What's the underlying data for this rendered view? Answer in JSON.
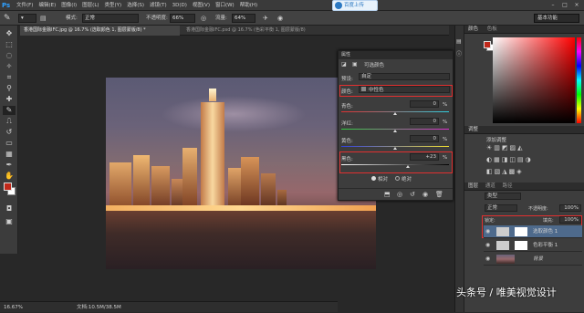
{
  "app": {
    "logo": "Ps"
  },
  "menu": {
    "items": [
      "文件(F)",
      "编辑(E)",
      "图像(I)",
      "图层(L)",
      "类型(Y)",
      "选择(S)",
      "滤镜(T)",
      "3D(D)",
      "视图(V)",
      "窗口(W)",
      "帮助(H)"
    ]
  },
  "cloud": {
    "label": "百度上传"
  },
  "options": {
    "mode_label": "模式:",
    "mode_value": "正常",
    "opacity_label": "不透明度:",
    "opacity_value": "66%",
    "flow_label": "流量:",
    "flow_value": "64%",
    "workspace": "基本功能"
  },
  "tabs": [
    "香港国际金融IFC.jpg @ 16.7% (选取颜色 1, 图层蒙版/8) *",
    "香港国际金融IFC.psd @ 16.7% (色彩平衡 1, 图层蒙版/8)"
  ],
  "status": {
    "zoom": "16.67%",
    "doc": "文档:10.5M/38.5M"
  },
  "properties": {
    "title": "属性",
    "header": "可选颜色",
    "preset_label": "预设:",
    "preset_value": "自定",
    "color_label": "颜色:",
    "color_value": "中性色",
    "rows": [
      {
        "label": "青色:",
        "value": "0",
        "unit": "%"
      },
      {
        "label": "洋红:",
        "value": "0",
        "unit": "%"
      },
      {
        "label": "黄色:",
        "value": "0",
        "unit": "%"
      },
      {
        "label": "黑色:",
        "value": "+23",
        "unit": "%"
      }
    ],
    "method_relative": "相对",
    "method_absolute": "绝对"
  },
  "panels": {
    "color_tab": "颜色",
    "swatch_tab": "色板",
    "adjust_tab": "调整",
    "adjust_title": "添加调整",
    "layers_tab": "图层",
    "channels_tab": "通道",
    "paths_tab": "路径",
    "kind_label": "类型",
    "blend_value": "正常",
    "opacity_label": "不透明度:",
    "opacity_value": "100%",
    "lock_label": "锁定:",
    "fill_label": "填充:",
    "fill_value": "100%",
    "layers": [
      {
        "name": "选取颜色 1"
      },
      {
        "name": "色彩平衡 1"
      },
      {
        "name": "背景"
      }
    ]
  },
  "watermark": {
    "text": "头条号 / 唯美视觉设计"
  },
  "colors": {
    "accent_red": "#e23030",
    "foreground": "#c0281a",
    "background": "#ffffff",
    "selected_layer": "#4e6a8c"
  }
}
